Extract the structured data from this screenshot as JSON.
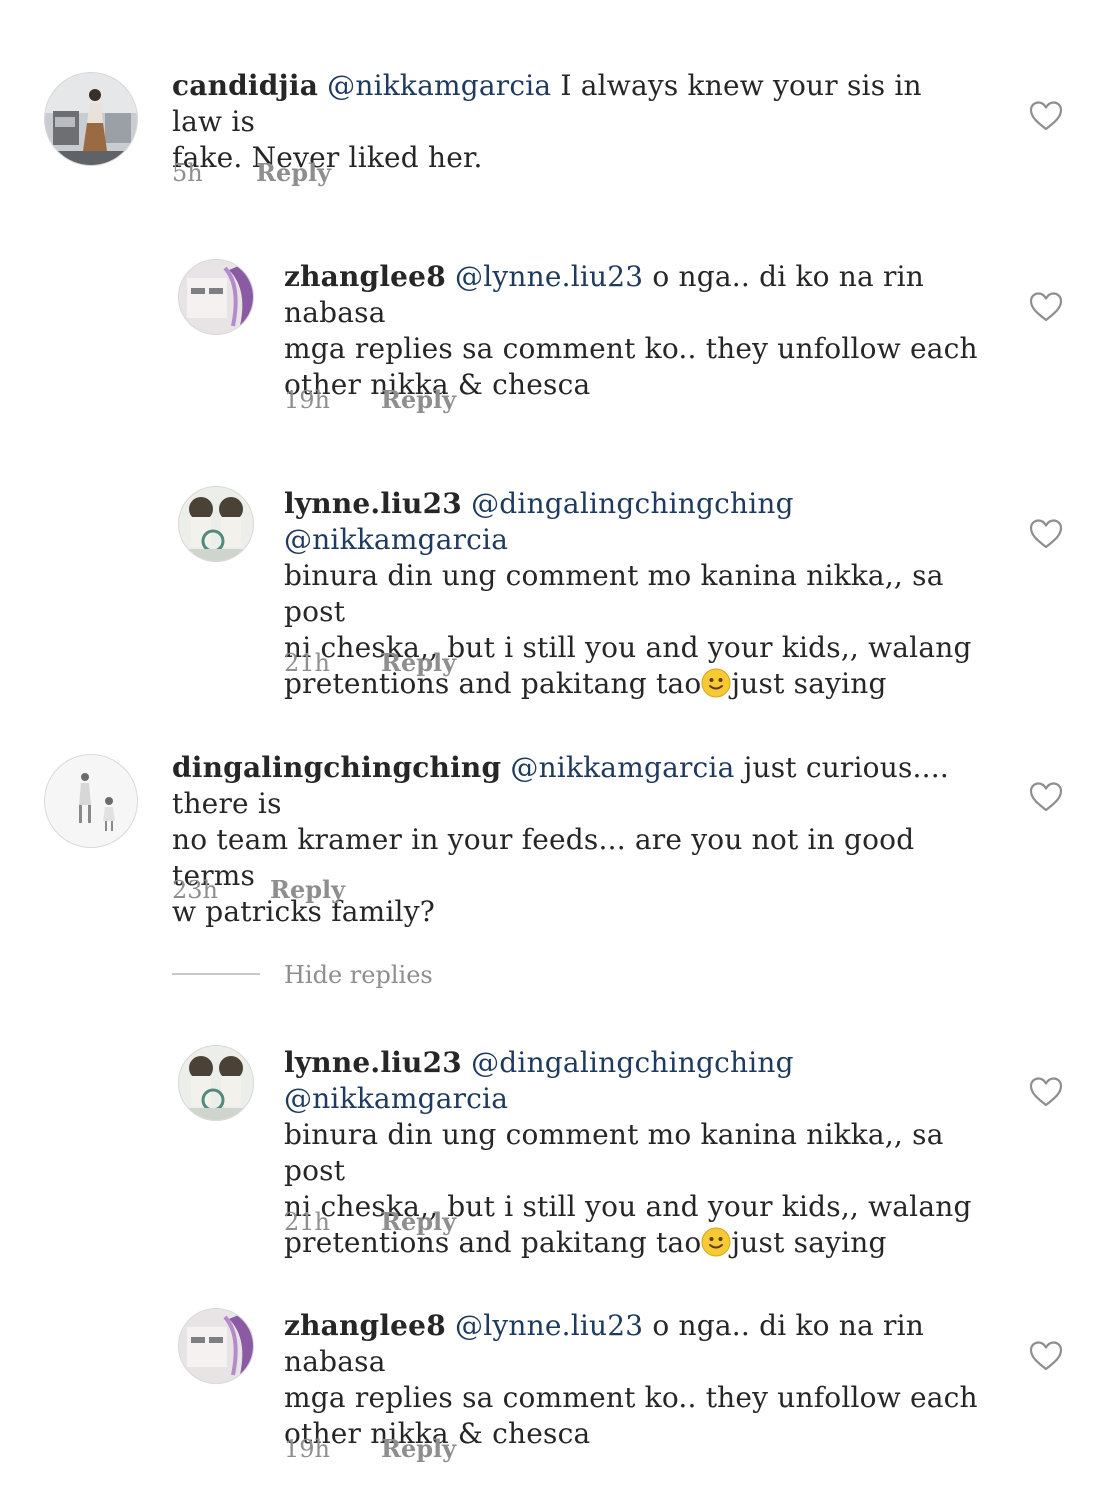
{
  "reply_label": "Reply",
  "hide_replies_label": "Hide replies",
  "comments": [
    {
      "user": "candidjia",
      "mention": "@nikkamgarcia",
      "line1_rest": " I always knew your sis in law is",
      "line2": "fake. Never liked her.",
      "time": "5h"
    },
    {
      "user": "zhanglee8",
      "mention": "@lynne.liu23",
      "line1_rest": " o nga.. di ko na rin nabasa",
      "line2": "mga replies sa comment ko.. they unfollow each",
      "line3": "other nikka & chesca",
      "time": "19h"
    },
    {
      "user": "lynne.liu23",
      "mention": "@dingalingchingching @nikkamgarcia",
      "line2": "binura din ung comment mo kanina nikka,, sa post",
      "line3": "ni cheska,, but i still you and your kids,, walang",
      "line4_a": "pretentions and pakitang tao",
      "line4_b": "just saying",
      "time": "21h"
    },
    {
      "user": "dingalingchingching",
      "mention": "@nikkamgarcia",
      "line1_rest": " just curious.... there is",
      "line2": "no team kramer in your feeds... are you not in good terms",
      "line3": "w patricks family?",
      "time": "23h"
    },
    {
      "user": "lynne.liu23",
      "mention": "@dingalingchingching @nikkamgarcia",
      "line2": "binura din ung comment mo kanina nikka,, sa post",
      "line3": "ni cheska,, but i still you and your kids,, walang",
      "line4_a": "pretentions and pakitang tao",
      "line4_b": "just saying",
      "time": "21h"
    },
    {
      "user": "zhanglee8",
      "mention": "@lynne.liu23",
      "line1_rest": " o nga.. di ko na rin nabasa",
      "line2": "mga replies sa comment ko.. they unfollow each",
      "line3": "other nikka & chesca",
      "time": "19h"
    }
  ],
  "icons": {
    "like": "heart-outline-icon",
    "emoji": "slightly-smiling-face-emoji"
  },
  "colors": {
    "text": "#262626",
    "mention": "#1f3a5f",
    "meta": "#8e8e8e"
  }
}
